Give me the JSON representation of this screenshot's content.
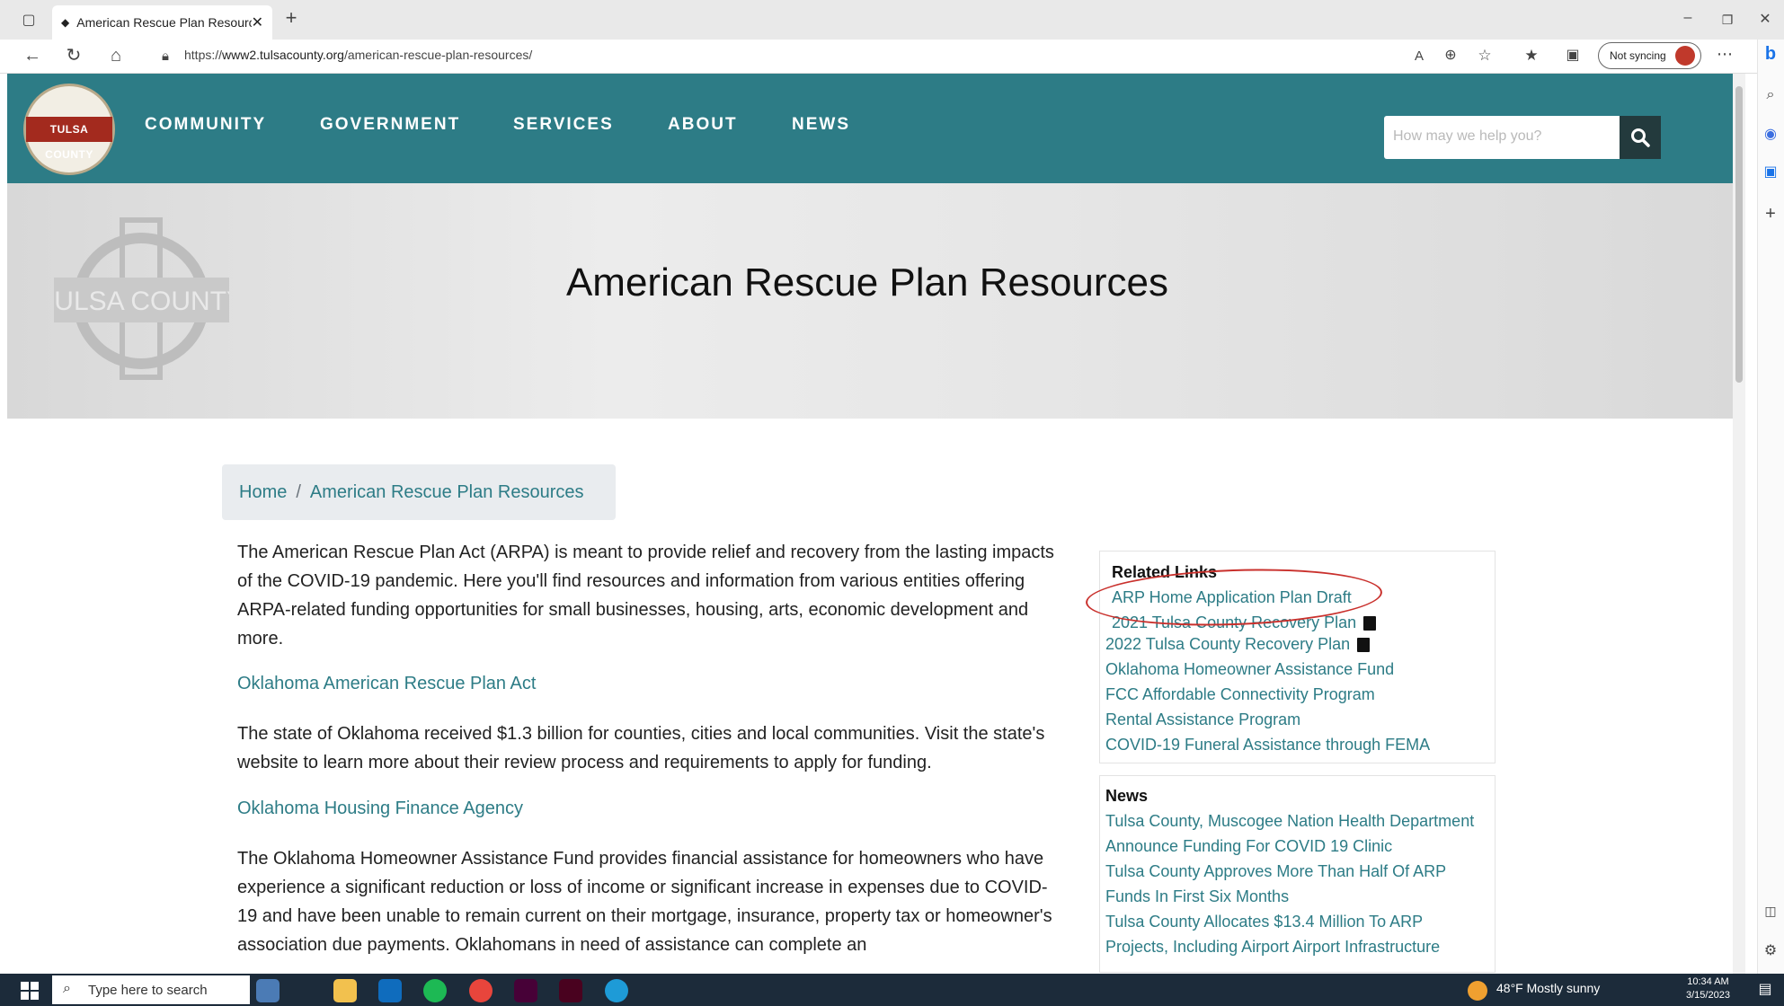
{
  "browser": {
    "tab_title": "American Rescue Plan Resource",
    "url_prefix": "https://",
    "url_host": "www2.tulsacounty.org",
    "url_path": "/american-rescue-plan-resources/",
    "sync_label": "Not syncing"
  },
  "site": {
    "logo_text": "TULSA COUNTY",
    "nav": [
      "COMMUNITY",
      "GOVERNMENT",
      "SERVICES",
      "ABOUT",
      "NEWS"
    ],
    "search_placeholder": "How may we help you?"
  },
  "hero": {
    "logo_text": "TULSA COUNTY",
    "title": "American Rescue Plan Resources"
  },
  "breadcrumb": {
    "home": "Home",
    "separator": "/",
    "current": "American Rescue Plan Resources"
  },
  "main": {
    "intro": "The American Rescue Plan Act (ARPA) is meant to provide relief and recovery from the lasting impacts of the COVID-19 pandemic. Here you'll find resources and information from various entities offering ARPA-related funding opportunities for small businesses, housing, arts, economic development and more.",
    "link1": "Oklahoma American Rescue Plan Act",
    "para1": "The state of Oklahoma received $1.3 billion for counties, cities and local communities. Visit the state's website to learn more about their review process and requirements to apply for funding.",
    "link2": "Oklahoma Housing Finance Agency",
    "para2": "The Oklahoma Homeowner Assistance Fund provides financial assistance for homeowners who have experience a significant reduction or loss of income or significant increase in expenses due to COVID-19 and have been unable to remain current on their mortgage, insurance, property tax or homeowner's association due payments. Oklahomans in need of assistance can complete an"
  },
  "related_links": {
    "heading": "Related Links",
    "items": [
      "ARP Home Application Plan Draft",
      "2021 Tulsa County Recovery Plan",
      "2022 Tulsa County Recovery Plan",
      "Oklahoma Homeowner Assistance Fund",
      "FCC Affordable Connectivity Program",
      "Rental Assistance Program",
      "COVID-19 Funeral Assistance through FEMA"
    ]
  },
  "news": {
    "heading": "News",
    "items": [
      "Tulsa County, Muscogee Nation Health Department",
      "Announce Funding For COVID 19 Clinic",
      "Tulsa County Approves More Than Half Of ARP",
      "Funds In First Six Months",
      "Tulsa County Allocates $13.4 Million To ARP",
      "Projects, Including Airport Airport Infrastructure"
    ]
  },
  "taskbar": {
    "search_placeholder": "Type here to search",
    "weather": "48°F  Mostly sunny",
    "time": "10:34 AM",
    "date": "3/15/2023"
  },
  "colors": {
    "teal": "#2d7c86",
    "annotation_red": "#c9302c"
  }
}
